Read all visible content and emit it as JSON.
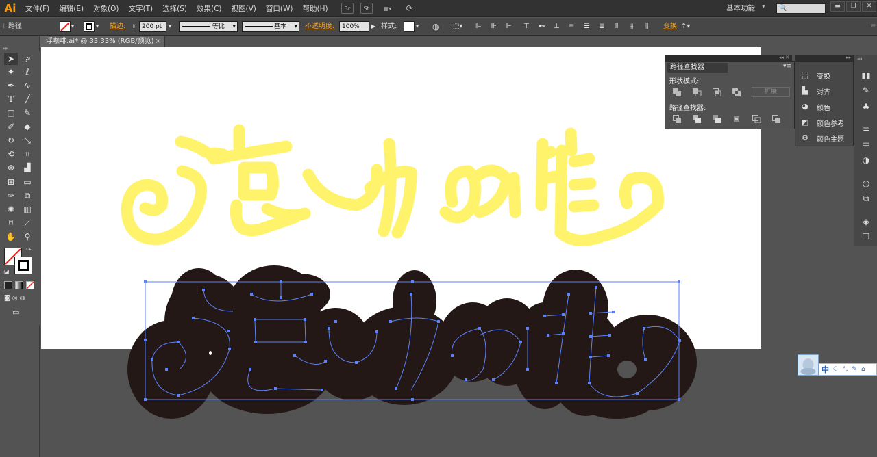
{
  "app": {
    "logo": "Ai"
  },
  "menu": [
    "文件(F)",
    "编辑(E)",
    "对象(O)",
    "文字(T)",
    "选择(S)",
    "效果(C)",
    "视图(V)",
    "窗口(W)",
    "帮助(H)"
  ],
  "menubar_buttons": [
    "Br",
    "St"
  ],
  "workspace": {
    "label": "基本功能",
    "search_placeholder": ""
  },
  "control_bar": {
    "selection_type": "路径",
    "stroke_label": "描边:",
    "stroke_weight": "200 pt",
    "profile_label": "等比",
    "brush_label": "基本",
    "opacity_label": "不透明度:",
    "opacity_value": "100%",
    "style_label": "样式:",
    "transform_label": "变换"
  },
  "document": {
    "tab_title": "浮咖啡.ai* @ 33.33% (RGB/预览)",
    "close": "×"
  },
  "pathfinder": {
    "title": "路径查找器",
    "shape_modes_label": "形状模式:",
    "expand_label": "扩展",
    "pathfinders_label": "路径查找器:"
  },
  "dock": [
    {
      "label": "变换",
      "icon": "transform-icon"
    },
    {
      "label": "对齐",
      "icon": "align-icon"
    },
    {
      "label": "颜色",
      "icon": "color-palette-icon"
    },
    {
      "label": "颜色参考",
      "icon": "color-guide-icon"
    },
    {
      "label": "颜色主题",
      "icon": "color-themes-icon"
    }
  ],
  "ime": {
    "lang": "中"
  },
  "colors": {
    "yellow_text": "#fff36b",
    "dark_outline": "#231815",
    "path_blue": "#3c6cff",
    "ui_dark": "#323232"
  }
}
